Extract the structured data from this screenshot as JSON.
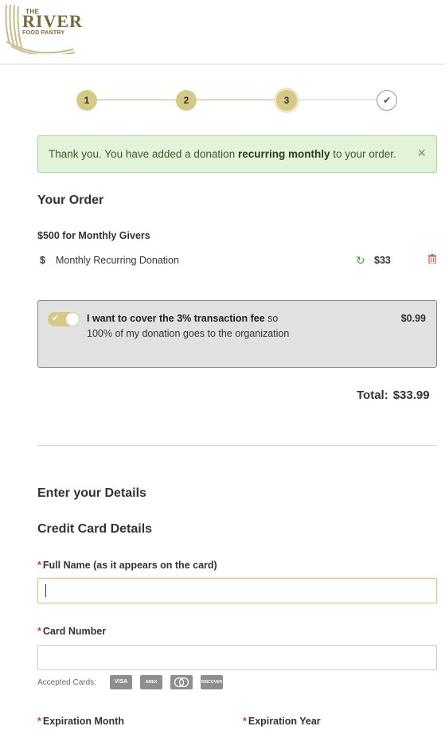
{
  "logo": {
    "line1": "THE",
    "line2": "RIVER",
    "line3": "FOOD PANTRY"
  },
  "steps": [
    {
      "label": "1"
    },
    {
      "label": "2"
    },
    {
      "label": "3"
    },
    {
      "label": "✔"
    }
  ],
  "alert": {
    "prefix": "Thank you. You have added a donation ",
    "bold": "recurring monthly",
    "suffix": " to your order.",
    "close": "×"
  },
  "order": {
    "heading": "Your Order",
    "package": "$500 for Monthly Givers",
    "item": {
      "symbol": "$",
      "name": "Monthly Recurring Donation",
      "price": "$33",
      "recur_icon": "↻",
      "trash_icon": "🗑"
    },
    "fee": {
      "bold": "I want to cover the 3% transaction fee",
      "rest": " so 100% of my donation goes to the organization",
      "amount": "$0.99",
      "enabled": true
    },
    "total_label": "Total:",
    "total_value": "$33.99"
  },
  "details": {
    "heading": "Enter your Details",
    "cc_heading": "Credit Card Details",
    "required_mark": "*",
    "full_name_label": "Full Name (as it appears on the card)",
    "full_name_value": "",
    "card_number_label": "Card Number",
    "card_number_value": "",
    "accepted_label": "Accepted Cards:",
    "cards": [
      "VISA",
      "AMEX",
      "MC",
      "DISCOVER"
    ],
    "exp_month_label": "Expiration Month",
    "exp_year_label": "Expiration Year"
  }
}
